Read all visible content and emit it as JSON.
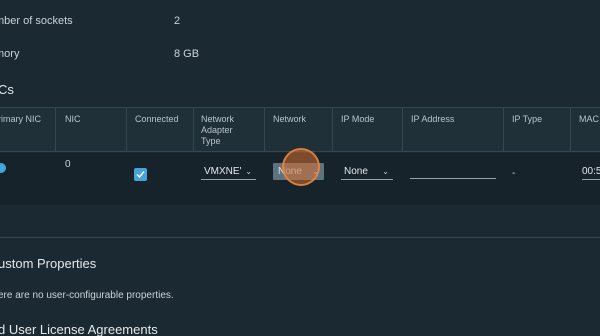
{
  "properties": [
    {
      "label": "mber of sockets",
      "value": "2"
    },
    {
      "label": "mory",
      "value": "8 GB"
    }
  ],
  "nics_section": {
    "title": "Cs"
  },
  "table": {
    "headers": {
      "primary_nic": "rimary NIC",
      "nic": "NIC",
      "connected": "Connected",
      "adapter_type": "Network\nAdapter\nType",
      "network": "Network",
      "ip_mode": "IP Mode",
      "ip_address": "IP Address",
      "ip_type": "IP Type",
      "mac": "MAC"
    },
    "row": {
      "nic": "0",
      "connected": true,
      "adapter_type": "VMXNE'",
      "network": "None",
      "ip_mode": "None",
      "ip_address": "",
      "ip_type": "-",
      "mac": "00:5"
    }
  },
  "custom_properties": {
    "title": "ustom Properties",
    "note": "ere are no user-configurable properties."
  },
  "eula": {
    "title": "d User License Agreements"
  },
  "colors": {
    "accent": "#49a3d9",
    "click_indicator": "#d66e2d"
  }
}
